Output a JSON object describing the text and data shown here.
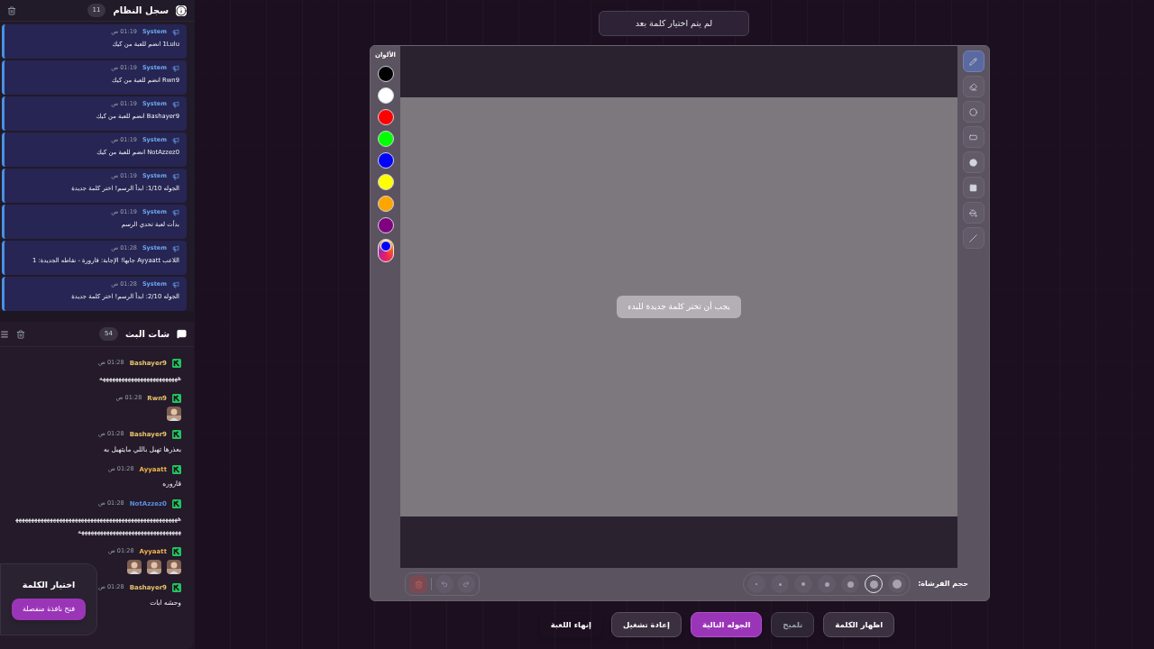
{
  "system_log": {
    "title": "سجل النظام",
    "count": "11",
    "entries": [
      {
        "sender": "System",
        "time": "01:19 ص",
        "text": "1Lulu انضم للعبة من كيك"
      },
      {
        "sender": "System",
        "time": "01:19 ص",
        "text": "Rwn9 انضم للعبة من كيك"
      },
      {
        "sender": "System",
        "time": "01:19 ص",
        "text": "Bashayer9 انضم للعبة من كيك"
      },
      {
        "sender": "System",
        "time": "01:19 ص",
        "text": "NotAzzez0 انضم للعبة من كيك"
      },
      {
        "sender": "System",
        "time": "01:19 ص",
        "text": "الجوله 1/10: ابدأ الرسم! اختر كلمة جديدة"
      },
      {
        "sender": "System",
        "time": "01:19 ص",
        "text": "بدأت لعبة تحدي الرسم"
      },
      {
        "sender": "System",
        "time": "01:28 ص",
        "text": "اللاعب Ayyaatt جابها! الإجابة: قارورة - نقاطه الجديدة: 1"
      },
      {
        "sender": "System",
        "time": "01:28 ص",
        "text": "الجوله 2/10: ابدأ الرسم! اختر كلمة جديدة"
      }
    ]
  },
  "chat": {
    "title": "شات البث",
    "count": "54",
    "messages": [
      {
        "user": "Bashayer9",
        "color": "#e7c46a",
        "time": "01:28 ص",
        "kind": "text",
        "text": "هههههههههههههههههههههههههه"
      },
      {
        "user": "Rwn9",
        "color": "#e7c46a",
        "time": "01:28 ص",
        "kind": "emotes"
      },
      {
        "user": "Bashayer9",
        "color": "#e7c46a",
        "time": "01:28 ص",
        "kind": "text",
        "text": "بعذرها تهبل باللي مايتهبل به"
      },
      {
        "user": "Ayyaatt",
        "color": "#f0b44c",
        "time": "01:28 ص",
        "kind": "text",
        "text": "قاروره"
      },
      {
        "user": "NotAzzez0",
        "color": "#5d8fe0",
        "time": "01:28 ص",
        "kind": "text",
        "text": "هههههههههههههههههههههههههههههههههههههههههههههههههههههههههههههههههههههههههههههههههههههه"
      },
      {
        "user": "Ayyaatt",
        "color": "#f0b44c",
        "time": "01:28 ص",
        "kind": "emotes"
      },
      {
        "user": "Bashayer9",
        "color": "#e7c46a",
        "time": "01:28 ص",
        "kind": "text",
        "text": "وحشه ابات"
      }
    ]
  },
  "word_picker": {
    "title": "اختيار الكلمة",
    "button": "فتح نافذة منفصلة"
  },
  "status": "لم يتم اختيار كلمة بعد",
  "board": {
    "colors_label": "الألوان",
    "colors": [
      {
        "color": "#000000"
      },
      {
        "color": "#ffffff"
      },
      {
        "color": "#ff0000"
      },
      {
        "color": "#00ff00"
      },
      {
        "color": "#0000ff"
      },
      {
        "color": "#ffff00"
      },
      {
        "color": "#ffa500"
      },
      {
        "color": "#800080"
      }
    ],
    "message": "يجب أن تختر كلمة جديدة للبدء",
    "tools": [
      {
        "kind": "pencil",
        "selected": true
      },
      {
        "kind": "eraser",
        "selected": false
      },
      {
        "kind": "circle",
        "selected": false
      },
      {
        "kind": "rectangle",
        "selected": false
      },
      {
        "kind": "filled-circle",
        "selected": false
      },
      {
        "kind": "filled-rectangle",
        "selected": false
      },
      {
        "kind": "fill",
        "selected": false
      },
      {
        "kind": "line",
        "selected": false
      }
    ],
    "brush_label": "حجم الفرشاة:",
    "brush_sizes": [
      {
        "selected": false
      },
      {
        "selected": true
      },
      {
        "selected": false
      },
      {
        "selected": false
      },
      {
        "selected": false
      },
      {
        "selected": false
      },
      {
        "selected": false
      }
    ]
  },
  "actions": [
    {
      "label": "اظهار الكلمة",
      "kind": "default"
    },
    {
      "label": "تلميح",
      "kind": "muted"
    },
    {
      "label": "الجوله التالية",
      "kind": "primary"
    },
    {
      "label": "إعادة تشغيل",
      "kind": "default"
    },
    {
      "label": "إنهاء اللعبة",
      "kind": "plain"
    }
  ]
}
